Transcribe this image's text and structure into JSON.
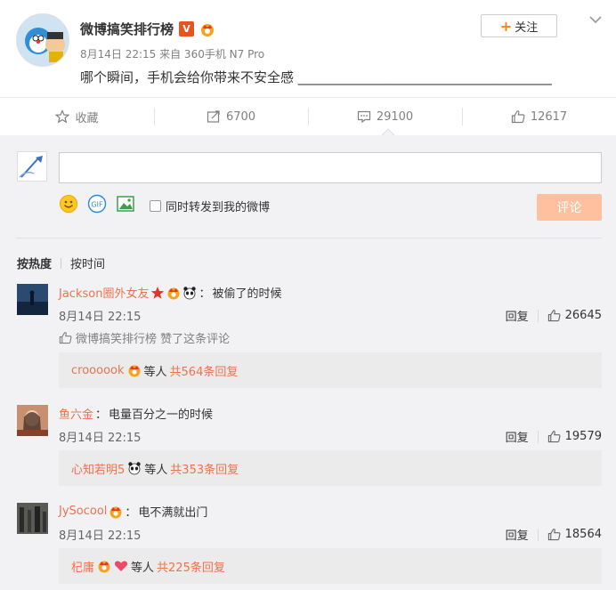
{
  "post": {
    "author": "微博搞笑排行榜",
    "v_badge": "V",
    "meta": "8月14日 22:15 来自 360手机 N7 Pro",
    "text": "哪个瞬间，手机会给你带来不安全感 ______________________________________",
    "follow_label": "关注",
    "follow_plus": "+"
  },
  "actions": {
    "favorite": {
      "label": "收藏",
      "icon": "star-outline-icon"
    },
    "repost": {
      "count": "6700",
      "icon": "repost-icon"
    },
    "comment": {
      "count": "29100",
      "icon": "comment-icon"
    },
    "like": {
      "count": "12617",
      "icon": "thumbs-up-icon"
    }
  },
  "composer": {
    "input_value": "",
    "forward_label": "同时转发到我的微博",
    "submit_label": "评论"
  },
  "sort": {
    "hot": "按热度",
    "time": "按时间"
  },
  "comments": [
    {
      "user": "Jackson圈外女友",
      "colon": "：",
      "text": "被偷了的时候",
      "time": "8月14日 22:15",
      "reply_label": "回复",
      "likes": "26645",
      "liked_by": "微博搞笑排行榜 赞了这条评论",
      "reply_preview": {
        "who": "croooook",
        "etc": "等人",
        "count": "共564条回复"
      }
    },
    {
      "user": "鱼六金",
      "colon": "：",
      "text": "电量百分之一的时候",
      "time": "8月14日 22:15",
      "reply_label": "回复",
      "likes": "19579",
      "reply_preview": {
        "who": "心知若明5",
        "etc": "等人",
        "count": "共353条回复"
      }
    },
    {
      "user": "JySocool",
      "colon": "：",
      "text": "电不满就出门",
      "time": "8月14日 22:15",
      "reply_label": "回复",
      "likes": "18564",
      "reply_preview": {
        "who": "杞庸",
        "etc": "等人",
        "count": "共225条回复"
      }
    }
  ],
  "colors": {
    "accent_orange": "#ff8200",
    "username": "#eb7350",
    "submit_disabled": "#ffc09f",
    "vip_badge": "#e8541e"
  }
}
